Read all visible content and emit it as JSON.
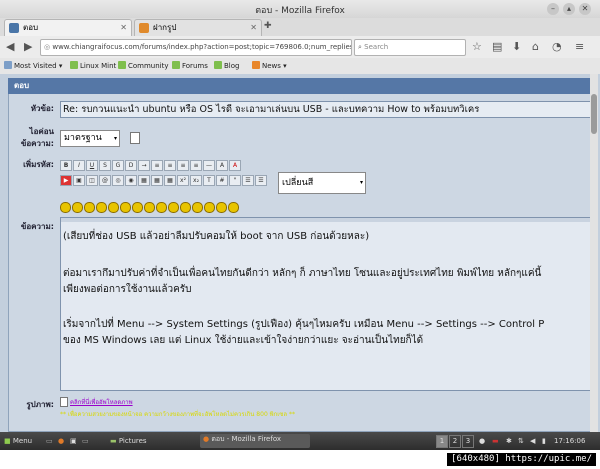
{
  "window": {
    "title": "ตอบ - Mozilla Firefox"
  },
  "tabs": [
    {
      "label": "ตอบ",
      "close": "✕"
    },
    {
      "label": "ฝากรูป",
      "close": "✕"
    }
  ],
  "new_tab_label": "✚",
  "nav": {
    "url": "www.chiangraifocus.com/forums/index.php?action=post;topic=769806.0;num_replies",
    "search_placeholder": "Search"
  },
  "bookmarks": [
    {
      "label": "Most Visited ▾"
    },
    {
      "label": "Linux Mint"
    },
    {
      "label": "Community"
    },
    {
      "label": "Forums"
    },
    {
      "label": "Blog"
    },
    {
      "label": "News ▾"
    }
  ],
  "form": {
    "header": "ตอบ",
    "subject_label": "หัวข้อ:",
    "subject_value": "Re: รบกวนแนะนำ ubuntu หรือ OS ไรดี จะเอามาเล่นบน USB - และบทความ How to พร้อมบทวิเคร",
    "icon_label_1": "ไอค่อน",
    "icon_label_2": "ข้อความ:",
    "icon_value": "มาตรฐาน",
    "format_label": "เพิ่มรหัส:",
    "color_value": "เปลี่ยนสี",
    "message_label": "ข้อความ:",
    "paragraphs": [
      "(เสียบที่ช่อง USB แล้วอย่าลืมปรับคอมให้ boot จาก USB ก่อนด้วยหละ)",
      "ต่อมาเรากึมาปรับค่าที่จำเป็นเพื่อคนไทยกันดีกว่า หลักๆ ก็ ภาษาไทย โซนและอยู่ประเทศไทย พิมพ์ไทย หลักๆแค่นี้",
      "เพียงพอต่อการใช้งานแล้วครับ",
      "เริ่มจากไปที่  Menu --> System Settings (รูปเฟือง) คุ้นๆไหมครับ เหมือน Menu --> Settings --> Control P",
      "ของ MS Windows เลย แต่ Linux ใช้ง่ายและเข้าใจง่ายกว่าแยะ จะอ่านเป็นไทยก็ได้"
    ],
    "image_label": "รูปภาพ:",
    "upload_link": "คลิกที่นี่เพื่ออัพโหลดภาพ",
    "upload_note": "** เพื่อความสวยงามของหน้าจอ ความกว้างของภาพที่จะอัพโหลดไม่ควรเกิน 800 พิกเซล **"
  },
  "taskbar": {
    "menu": "Menu",
    "pictures": "Pictures",
    "firefox_task": "ตอบ - Mozilla Firefox",
    "workspaces": [
      "1",
      "2",
      "3"
    ],
    "clock": "17:16:06"
  },
  "watermark": "[640x480] https://upic.me/",
  "colors": {
    "panel_header": "#5577a6",
    "panel_bg": "#cdd7e3",
    "accent_link": "#9900cc"
  }
}
